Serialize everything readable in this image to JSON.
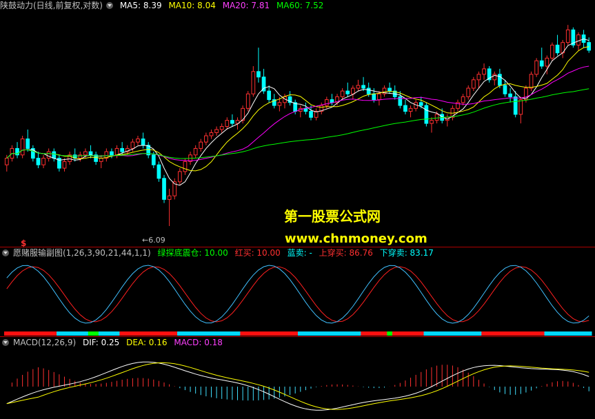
{
  "colors": {
    "up": "#ff3030",
    "down": "#00ffff",
    "ma5": "#ffffff",
    "ma10": "#ffff00",
    "ma20": "#ff00ff",
    "ma60": "#00ff00",
    "frame": "#b00000"
  },
  "main": {
    "title": "陕鼓动力(日线,前复权,对数)",
    "menu_icon": "dropdown-icon",
    "ma5_label": "MA5: 8.39",
    "ma10_label": "MA10: 8.04",
    "ma20_label": "MA20: 7.81",
    "ma60_label": "MA60: 7.52",
    "low_label": "←6.09",
    "signal_mark": "$"
  },
  "watermark": {
    "line1": "第一股票公式网",
    "line2": "www.chnmoney.com"
  },
  "indicator": {
    "name": "愿赌服输副图(1,26,3,90,21,44,1,1)",
    "green": "绿探底震仓: 10.00",
    "red": "红买: 10.00",
    "blue": "蓝卖: -",
    "up": "上穿买: 86.76",
    "down": "下穿卖: 83.17"
  },
  "macd": {
    "name": "MACD(12,26,9)",
    "dif": "DIF: 0.25",
    "dea": "DEA: 0.16",
    "macd": "MACD: 0.18"
  },
  "chart_data": {
    "type": "candlestick",
    "scale": "log",
    "ylim": [
      6.0,
      9.6
    ],
    "ohlc": [
      [
        6.95,
        7.1,
        6.85,
        7.05
      ],
      [
        7.05,
        7.25,
        7.0,
        7.2
      ],
      [
        7.2,
        7.3,
        7.05,
        7.1
      ],
      [
        7.1,
        7.4,
        7.05,
        7.35
      ],
      [
        7.35,
        7.5,
        7.15,
        7.2
      ],
      [
        7.2,
        7.25,
        7.0,
        7.05
      ],
      [
        7.05,
        7.15,
        6.9,
        6.95
      ],
      [
        6.95,
        7.1,
        6.9,
        7.05
      ],
      [
        7.05,
        7.2,
        7.0,
        7.15
      ],
      [
        7.15,
        7.2,
        7.0,
        7.05
      ],
      [
        7.05,
        7.1,
        6.85,
        6.9
      ],
      [
        6.9,
        7.05,
        6.85,
        7.0
      ],
      [
        7.0,
        7.15,
        6.95,
        7.1
      ],
      [
        7.1,
        7.2,
        7.0,
        7.05
      ],
      [
        7.05,
        7.15,
        7.0,
        7.1
      ],
      [
        7.1,
        7.2,
        7.05,
        7.15
      ],
      [
        7.15,
        7.25,
        7.05,
        7.1
      ],
      [
        7.1,
        7.15,
        6.95,
        7.0
      ],
      [
        7.0,
        7.1,
        6.9,
        7.05
      ],
      [
        7.05,
        7.2,
        7.0,
        7.15
      ],
      [
        7.15,
        7.2,
        7.05,
        7.1
      ],
      [
        7.1,
        7.25,
        7.05,
        7.2
      ],
      [
        7.2,
        7.3,
        7.1,
        7.15
      ],
      [
        7.15,
        7.25,
        7.1,
        7.2
      ],
      [
        7.2,
        7.35,
        7.15,
        7.3
      ],
      [
        7.3,
        7.4,
        7.25,
        7.35
      ],
      [
        7.35,
        7.45,
        7.2,
        7.25
      ],
      [
        7.25,
        7.3,
        7.05,
        7.1
      ],
      [
        7.1,
        7.15,
        6.9,
        6.95
      ],
      [
        6.95,
        7.0,
        6.7,
        6.75
      ],
      [
        6.75,
        6.8,
        6.4,
        6.45
      ],
      [
        6.45,
        6.6,
        6.09,
        6.5
      ],
      [
        6.5,
        6.75,
        6.45,
        6.7
      ],
      [
        6.7,
        6.9,
        6.65,
        6.85
      ],
      [
        6.85,
        7.05,
        6.8,
        7.0
      ],
      [
        7.0,
        7.15,
        6.95,
        7.1
      ],
      [
        7.1,
        7.25,
        7.05,
        7.2
      ],
      [
        7.2,
        7.35,
        7.15,
        7.3
      ],
      [
        7.3,
        7.45,
        7.25,
        7.4
      ],
      [
        7.4,
        7.5,
        7.35,
        7.45
      ],
      [
        7.45,
        7.55,
        7.4,
        7.5
      ],
      [
        7.5,
        7.6,
        7.45,
        7.55
      ],
      [
        7.55,
        7.7,
        7.5,
        7.65
      ],
      [
        7.65,
        7.75,
        7.55,
        7.6
      ],
      [
        7.6,
        7.7,
        7.5,
        7.65
      ],
      [
        7.65,
        7.9,
        7.6,
        7.85
      ],
      [
        7.85,
        8.15,
        7.8,
        8.1
      ],
      [
        8.1,
        8.6,
        8.05,
        8.5
      ],
      [
        8.5,
        8.95,
        8.3,
        8.4
      ],
      [
        8.4,
        8.55,
        8.1,
        8.15
      ],
      [
        8.15,
        8.25,
        7.95,
        8.0
      ],
      [
        8.0,
        8.1,
        7.85,
        7.9
      ],
      [
        7.9,
        8.05,
        7.8,
        7.95
      ],
      [
        7.95,
        8.1,
        7.85,
        8.05
      ],
      [
        8.05,
        8.15,
        7.9,
        7.95
      ],
      [
        7.95,
        8.0,
        7.75,
        7.8
      ],
      [
        7.8,
        7.9,
        7.7,
        7.85
      ],
      [
        7.85,
        7.95,
        7.75,
        7.8
      ],
      [
        7.8,
        7.9,
        7.65,
        7.7
      ],
      [
        7.7,
        7.85,
        7.65,
        7.8
      ],
      [
        7.8,
        7.95,
        7.75,
        7.9
      ],
      [
        7.9,
        8.05,
        7.85,
        8.0
      ],
      [
        8.0,
        8.1,
        7.9,
        7.95
      ],
      [
        7.95,
        8.1,
        7.9,
        8.05
      ],
      [
        8.05,
        8.2,
        8.0,
        8.15
      ],
      [
        8.15,
        8.3,
        8.05,
        8.1
      ],
      [
        8.1,
        8.25,
        8.0,
        8.2
      ],
      [
        8.2,
        8.35,
        8.15,
        8.25
      ],
      [
        8.25,
        8.4,
        8.15,
        8.2
      ],
      [
        8.2,
        8.3,
        8.05,
        8.1
      ],
      [
        8.1,
        8.2,
        7.95,
        8.0
      ],
      [
        8.0,
        8.15,
        7.9,
        8.1
      ],
      [
        8.1,
        8.25,
        8.05,
        8.2
      ],
      [
        8.2,
        8.3,
        8.1,
        8.15
      ],
      [
        8.15,
        8.25,
        8.0,
        8.05
      ],
      [
        8.05,
        8.15,
        7.85,
        7.9
      ],
      [
        7.9,
        8.0,
        7.75,
        7.8
      ],
      [
        7.8,
        7.9,
        7.7,
        7.85
      ],
      [
        7.85,
        8.0,
        7.8,
        7.95
      ],
      [
        7.95,
        8.05,
        7.85,
        7.9
      ],
      [
        7.9,
        7.95,
        7.55,
        7.6
      ],
      [
        7.6,
        7.7,
        7.45,
        7.65
      ],
      [
        7.65,
        7.8,
        7.6,
        7.75
      ],
      [
        7.75,
        7.85,
        7.6,
        7.65
      ],
      [
        7.65,
        7.75,
        7.55,
        7.7
      ],
      [
        7.7,
        7.9,
        7.65,
        7.85
      ],
      [
        7.85,
        8.0,
        7.8,
        7.95
      ],
      [
        7.95,
        8.1,
        7.9,
        8.05
      ],
      [
        8.05,
        8.25,
        8.0,
        8.2
      ],
      [
        8.2,
        8.4,
        8.15,
        8.35
      ],
      [
        8.35,
        8.5,
        8.2,
        8.45
      ],
      [
        8.45,
        8.65,
        8.35,
        8.55
      ],
      [
        8.55,
        8.6,
        8.3,
        8.35
      ],
      [
        8.35,
        8.5,
        8.25,
        8.45
      ],
      [
        8.45,
        8.55,
        8.2,
        8.25
      ],
      [
        8.25,
        8.35,
        8.05,
        8.1
      ],
      [
        8.1,
        8.2,
        7.95,
        8.05
      ],
      [
        8.05,
        8.15,
        7.7,
        7.75
      ],
      [
        7.75,
        8.05,
        7.6,
        8.0
      ],
      [
        8.0,
        8.25,
        7.95,
        8.2
      ],
      [
        8.2,
        8.5,
        8.15,
        8.45
      ],
      [
        8.45,
        8.75,
        8.4,
        8.7
      ],
      [
        8.7,
        8.95,
        8.55,
        8.6
      ],
      [
        8.6,
        8.8,
        8.45,
        8.75
      ],
      [
        8.75,
        9.05,
        8.7,
        9.0
      ],
      [
        9.0,
        9.2,
        8.8,
        8.85
      ],
      [
        8.85,
        9.1,
        8.75,
        9.05
      ],
      [
        9.05,
        9.4,
        9.0,
        9.3
      ],
      [
        9.3,
        9.35,
        8.95,
        9.0
      ],
      [
        9.0,
        9.25,
        8.9,
        9.2
      ],
      [
        9.2,
        9.3,
        8.95,
        9.05
      ],
      [
        9.05,
        9.15,
        8.85,
        8.9
      ]
    ],
    "ma_last": {
      "ma5": 8.39,
      "ma10": 8.04,
      "ma20": 7.81,
      "ma60": 7.52
    },
    "low_annotation": 6.09
  }
}
